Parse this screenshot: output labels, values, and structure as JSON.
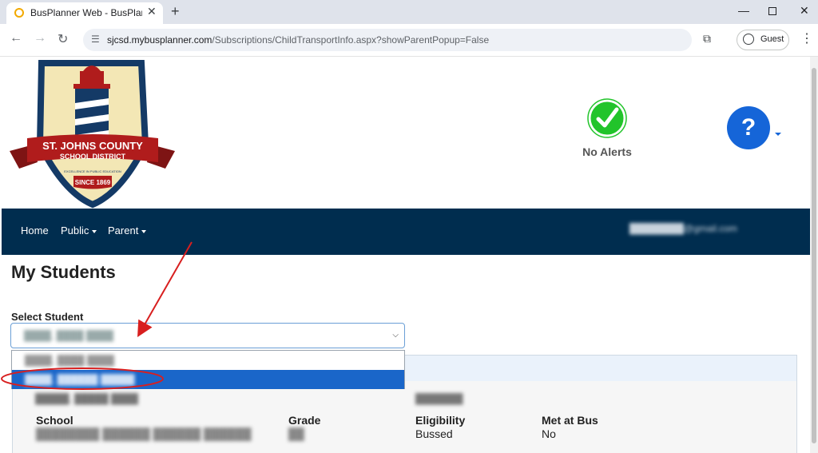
{
  "browser": {
    "tab_title": "BusPlanner Web - BusPlanner W",
    "tab_close": "✕",
    "new_tab": "+",
    "url_host": "sjcsd.mybusplanner.com",
    "url_path": "/Subscriptions/ChildTransportInfo.aspx?showParentPopup=False",
    "guest_label": "Guest",
    "icons": [
      "back-icon",
      "forward-icon",
      "reload-icon",
      "site-settings-icon",
      "lens-icon",
      "profile-icon",
      "menu-icon",
      "minimize-icon",
      "maximize-icon",
      "close-icon"
    ]
  },
  "header": {
    "logo": {
      "line1": "ST. JOHNS COUNTY",
      "line2": "SCHOOL DISTRICT",
      "motto": "EXCELLENCE IN PUBLIC EDUCATION",
      "since": "SINCE 1869"
    },
    "alerts_label": "No Alerts",
    "help_symbol": "?"
  },
  "nav": {
    "items": [
      {
        "label": "Home"
      },
      {
        "label": "Public"
      },
      {
        "label": "Parent"
      }
    ],
    "user_email": "████████@gmail.com"
  },
  "main": {
    "title": "My Students",
    "select_label": "Select Student",
    "selected_value": "████, ████ ████",
    "dropdown_options": [
      {
        "label": "████, ████ ████",
        "selected": false
      },
      {
        "label": "████, ██████ █████",
        "selected": true
      }
    ],
    "card": {
      "name": "█████, █████ ████",
      "id": "███████",
      "fields": [
        {
          "label": "School",
          "value": "████████ ██████ ██████ ██████"
        },
        {
          "label": "Grade",
          "value": "██"
        },
        {
          "label": "Eligibility",
          "value": "Bussed"
        },
        {
          "label": "Met at Bus",
          "value": "No"
        }
      ]
    }
  },
  "colors": {
    "navbar": "#002d4f",
    "accent_blue": "#1565d8",
    "selected_option": "#1a66c9",
    "annotation": "#d81f1f",
    "alert_green": "#22c42b"
  }
}
